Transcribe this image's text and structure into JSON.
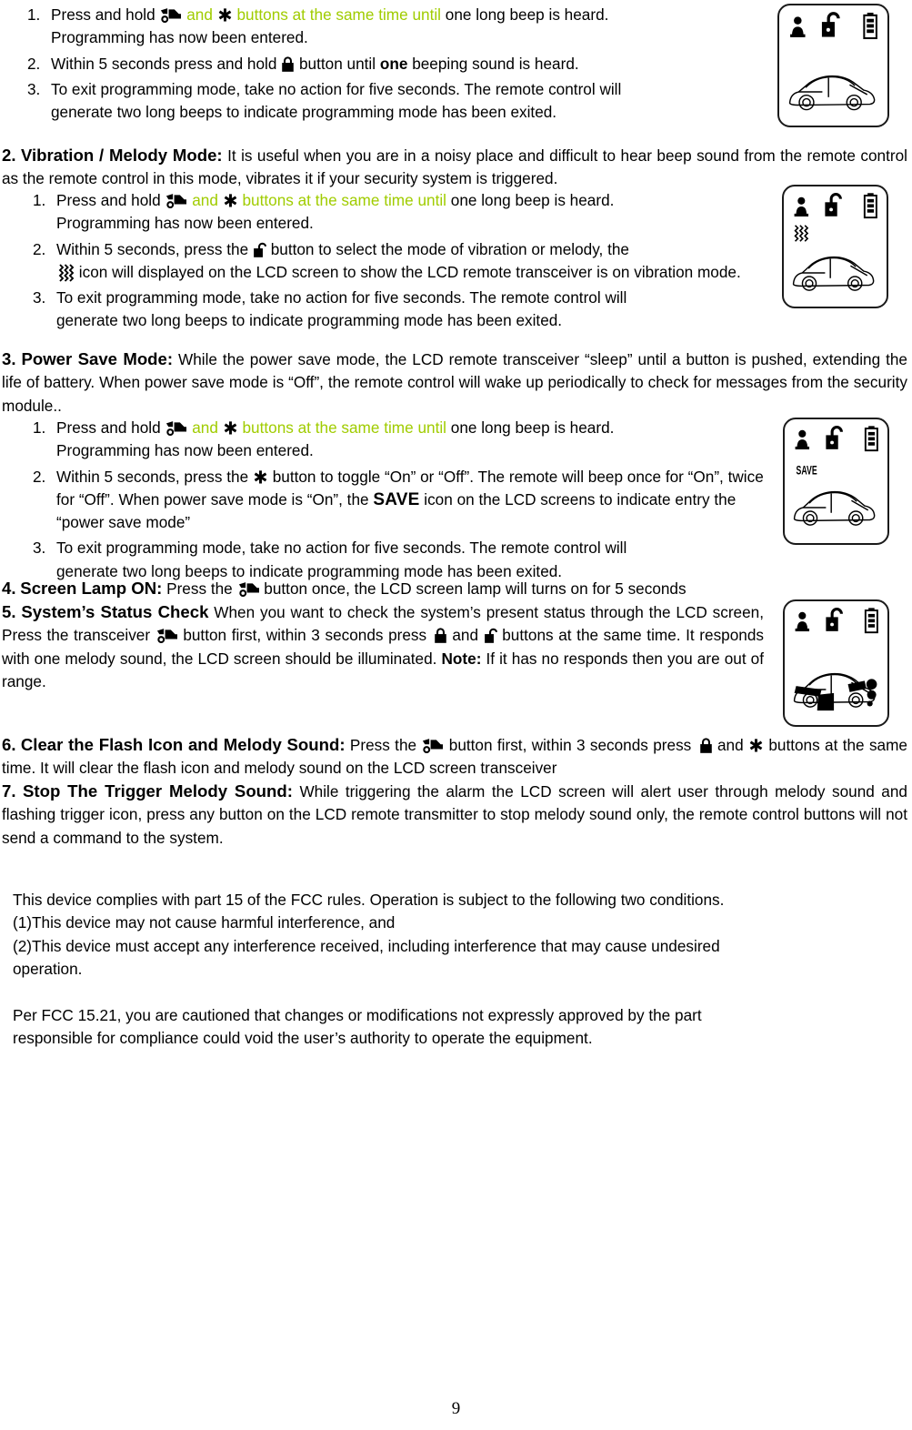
{
  "document": {
    "page_number": "9",
    "accent_green": "#A0CC00"
  },
  "section_top": {
    "steps": [
      {
        "marker": "1.",
        "pre": "Press and hold",
        "icon_1": "transceiver-icon",
        "green_and": "and",
        "icon_2": "star-icon",
        "green_tail": "buttons at the same time until",
        "post": "one long beep is heard.",
        "line2": "Programming has now been entered."
      },
      {
        "marker": "2.",
        "pre": "Within 5 seconds press and hold",
        "icon_1": "lock-icon",
        "mid": "button until",
        "bold": "one",
        "post": "beeping sound is heard."
      },
      {
        "marker": "3.",
        "line1": "To exit programming mode, take no action for five seconds. The remote control will",
        "line2": "generate two long beeps to indicate programming mode has been exited."
      }
    ]
  },
  "section_2": {
    "number": "2.",
    "title": "Vibration / Melody Mode:",
    "intro": "It is useful when you are in a noisy place and difficult to hear beep sound from the remote control as the remote control in this mode, vibrates it if your security system is triggered.",
    "steps": [
      {
        "marker": "1.",
        "pre": "Press and hold",
        "icon_1": "transceiver-icon",
        "green_and": "and",
        "icon_2": "star-icon",
        "green_tail": "buttons at the same time until",
        "post": "one long beep is heard.",
        "line2": "Programming has now been entered."
      },
      {
        "marker": "2.",
        "pre": "Within 5 seconds, press the",
        "icon_1": "unlock-icon",
        "mid": "button to select the mode of vibration or melody, the",
        "icon_2": "vibration-icon",
        "tail": "icon will displayed on the LCD screen to show the LCD remote transceiver is on vibration mode."
      },
      {
        "marker": "3.",
        "line1": "To exit programming mode, take no action for five seconds. The remote control will",
        "line2": "generate two long beeps to indicate programming mode has been exited."
      }
    ]
  },
  "section_3": {
    "number": "3.",
    "title": "Power Save Mode:",
    "intro": "While the power save mode, the LCD remote transceiver “sleep” until a button is pushed, extending the life of battery. When power save mode is “Off”, the remote control will wake up periodically to check for messages from the security module..",
    "steps": [
      {
        "marker": "1.",
        "pre": "Press and hold",
        "icon_1": "transceiver-icon",
        "green_and": "and",
        "icon_2": "star-icon",
        "green_tail": "buttons at the same time until",
        "post": "one long beep is heard.",
        "line2": "Programming has now been entered."
      },
      {
        "marker": "2.",
        "pre": "Within 5 seconds, press the",
        "icon_1": "star-icon",
        "mid": "button to toggle “On” or “Off”. The remote will beep once for “On”, twice for “Off”. When power save mode is “On”, the",
        "save_word": "SAVE",
        "tail": "icon on the LCD screens to indicate entry the “power save mode”"
      },
      {
        "marker": "3.",
        "line1": "To exit programming mode, take no action for five seconds. The remote control will",
        "line2": "generate two long beeps to indicate programming mode has been exited."
      }
    ]
  },
  "section_4": {
    "number": "4.",
    "title": "Screen Lamp ON:",
    "pre": "Press the",
    "icon_1": "transceiver-icon",
    "post": "button once, the LCD screen lamp will turns on for 5 seconds"
  },
  "section_5": {
    "number": "5.",
    "title": "System’s Status Check",
    "part1": "When you want to check the system’s present status through the LCD screen, Press the transceiver",
    "icon_1": "transceiver-icon",
    "part2": "button first, within 3 seconds press",
    "icon_2": "lock-icon",
    "part3": "and",
    "icon_3": "unlock-icon",
    "part4": "buttons at the same time. It responds with one melody sound, the LCD screen should be illuminated.",
    "note_label": "Note:",
    "note_text": "If it has no responds then you are out of range."
  },
  "section_6": {
    "number": "6.",
    "title": "Clear the Flash Icon and Melody Sound:",
    "part1": "Press the",
    "icon_1": "transceiver-icon",
    "part2": "button first, within 3 seconds press",
    "icon_2": "lock-icon",
    "part3": "and",
    "icon_3": "star-icon",
    "part4": "buttons at the same time. It will clear the flash icon and melody sound on the LCD screen transceiver"
  },
  "section_7": {
    "number": "7.",
    "title": "Stop The Trigger Melody Sound:",
    "body": "While triggering the alarm the LCD screen will alert user through melody sound and flashing trigger icon, press any button on the LCD remote transmitter to stop melody sound only, the remote control buttons will not send a command to the system."
  },
  "fcc": {
    "line1": "This device complies with part 15 of the FCC rules. Operation is subject to the following two conditions.",
    "line2": "(1)This device may not cause harmful interference, and",
    "line3": "(2)This device must accept any interference received, including interference that may cause undesired",
    "line4": "operation.",
    "line5": "Per FCC 15.21, you are cautioned that changes or modifications not expressly approved by the part",
    "line6": "responsible for compliance could void the user’s authority to operate the equipment."
  },
  "lcd_panels": [
    {
      "name": "lcd-panel-1",
      "icons": [
        "person-icon",
        "unlock-icon",
        "battery-icon"
      ],
      "status_text": "",
      "vibration": false,
      "trigger_marks": false
    },
    {
      "name": "lcd-panel-2",
      "icons": [
        "person-icon",
        "unlock-icon",
        "battery-icon"
      ],
      "status_text": "",
      "vibration": true,
      "trigger_marks": false
    },
    {
      "name": "lcd-panel-3",
      "icons": [
        "person-icon",
        "unlock-icon",
        "battery-icon"
      ],
      "status_text": "SAVE",
      "vibration": false,
      "trigger_marks": false
    },
    {
      "name": "lcd-panel-4",
      "icons": [
        "person-icon",
        "unlock-icon",
        "battery-icon"
      ],
      "status_text": "",
      "vibration": false,
      "trigger_marks": true
    }
  ]
}
